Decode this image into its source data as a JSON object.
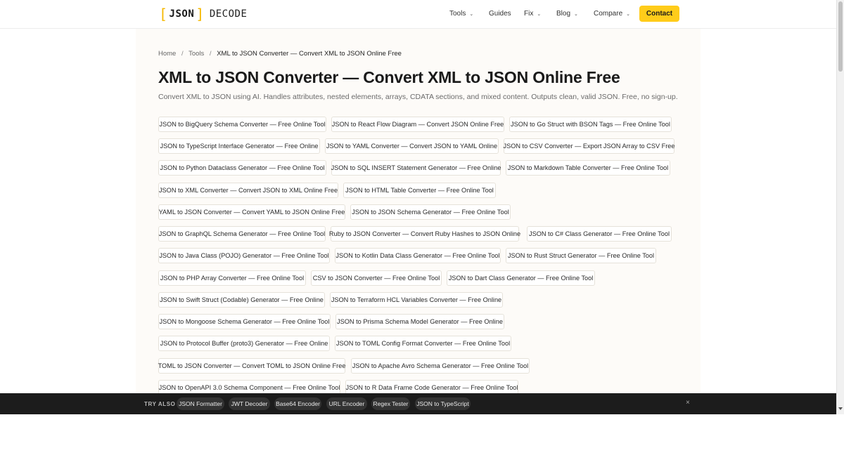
{
  "header": {
    "logo_bracket_open": "[",
    "logo_json": "JSON",
    "logo_bracket_close": "]",
    "logo_decode": "DECODE",
    "nav": [
      {
        "label": "Tools",
        "dropdown": true
      },
      {
        "label": "Guides",
        "dropdown": false
      },
      {
        "label": "Fix",
        "dropdown": true
      },
      {
        "label": "Blog",
        "dropdown": true
      },
      {
        "label": "Compare",
        "dropdown": true
      }
    ],
    "chevron": "⌄",
    "contact_label": "Contact",
    "accent_color": "#ffcc1a"
  },
  "breadcrumb": {
    "home": "Home",
    "tools": "Tools",
    "separator": "/",
    "current": "XML to JSON Converter — Convert XML to JSON Online Free"
  },
  "page": {
    "title": "XML to JSON Converter — Convert XML to JSON Online Free",
    "description": "Convert XML to JSON using AI. Handles attributes, nested elements, arrays, CDATA sections, and mixed content. Outputs clean, valid JSON. Free, no sign-up."
  },
  "related_tools": [
    [
      "JSON to BigQuery Schema Converter — Free Online Tool",
      "JSON to React Flow Diagram — Convert JSON Online Free",
      "JSON to Go Struct with BSON Tags — Free Online Tool"
    ],
    [
      "JSON to TypeScript Interface Generator — Free Online",
      "JSON to YAML Converter — Convert JSON to YAML Online",
      "JSON to CSV Converter — Export JSON Array to CSV Free"
    ],
    [
      "JSON to Python Dataclass Generator — Free Online Tool",
      "JSON to SQL INSERT Statement Generator — Free Online",
      "JSON to Markdown Table Converter — Free Online Tool"
    ],
    [
      "JSON to XML Converter — Convert JSON to XML Online Free",
      "JSON to HTML Table Converter — Free Online Tool"
    ],
    [
      "YAML to JSON Converter — Convert YAML to JSON Online Free",
      "JSON to JSON Schema Generator — Free Online Tool"
    ],
    [
      "JSON to GraphQL Schema Generator — Free Online Tool",
      "Ruby to JSON Converter — Convert Ruby Hashes to JSON Online",
      "JSON to C# Class Generator — Free Online Tool"
    ],
    [
      "JSON to Java Class (POJO) Generator — Free Online Tool",
      "JSON to Kotlin Data Class Generator — Free Online Tool",
      "JSON to Rust Struct Generator — Free Online Tool"
    ],
    [
      "JSON to PHP Array Converter — Free Online Tool",
      "CSV to JSON Converter — Free Online Tool",
      "JSON to Dart Class Generator — Free Online Tool"
    ],
    [
      "JSON to Swift Struct (Codable) Generator — Free Online",
      "JSON to Terraform HCL Variables Converter — Free Online"
    ],
    [
      "JSON to Mongoose Schema Generator — Free Online Tool",
      "JSON to Prisma Schema Model Generator — Free Online"
    ],
    [
      "JSON to Protocol Buffer (proto3) Generator — Free Online",
      "JSON to TOML Config Format Converter — Free Online Tool"
    ],
    [
      "TOML to JSON Converter — Convert TOML to JSON Online Free",
      "JSON to Apache Avro Schema Generator — Free Online Tool"
    ],
    [
      "JSON to OpenAPI 3.0 Schema Component — Free Online Tool",
      "JSON to R Data Frame Code Generator — Free Online Tool"
    ]
  ],
  "try_also": {
    "label": "TRY ALSO",
    "items": [
      "JSON Formatter",
      "JWT Decoder",
      "Base64 Encoder",
      "URL Encoder",
      "Regex Tester",
      "JSON to TypeScript"
    ],
    "close": "×"
  }
}
